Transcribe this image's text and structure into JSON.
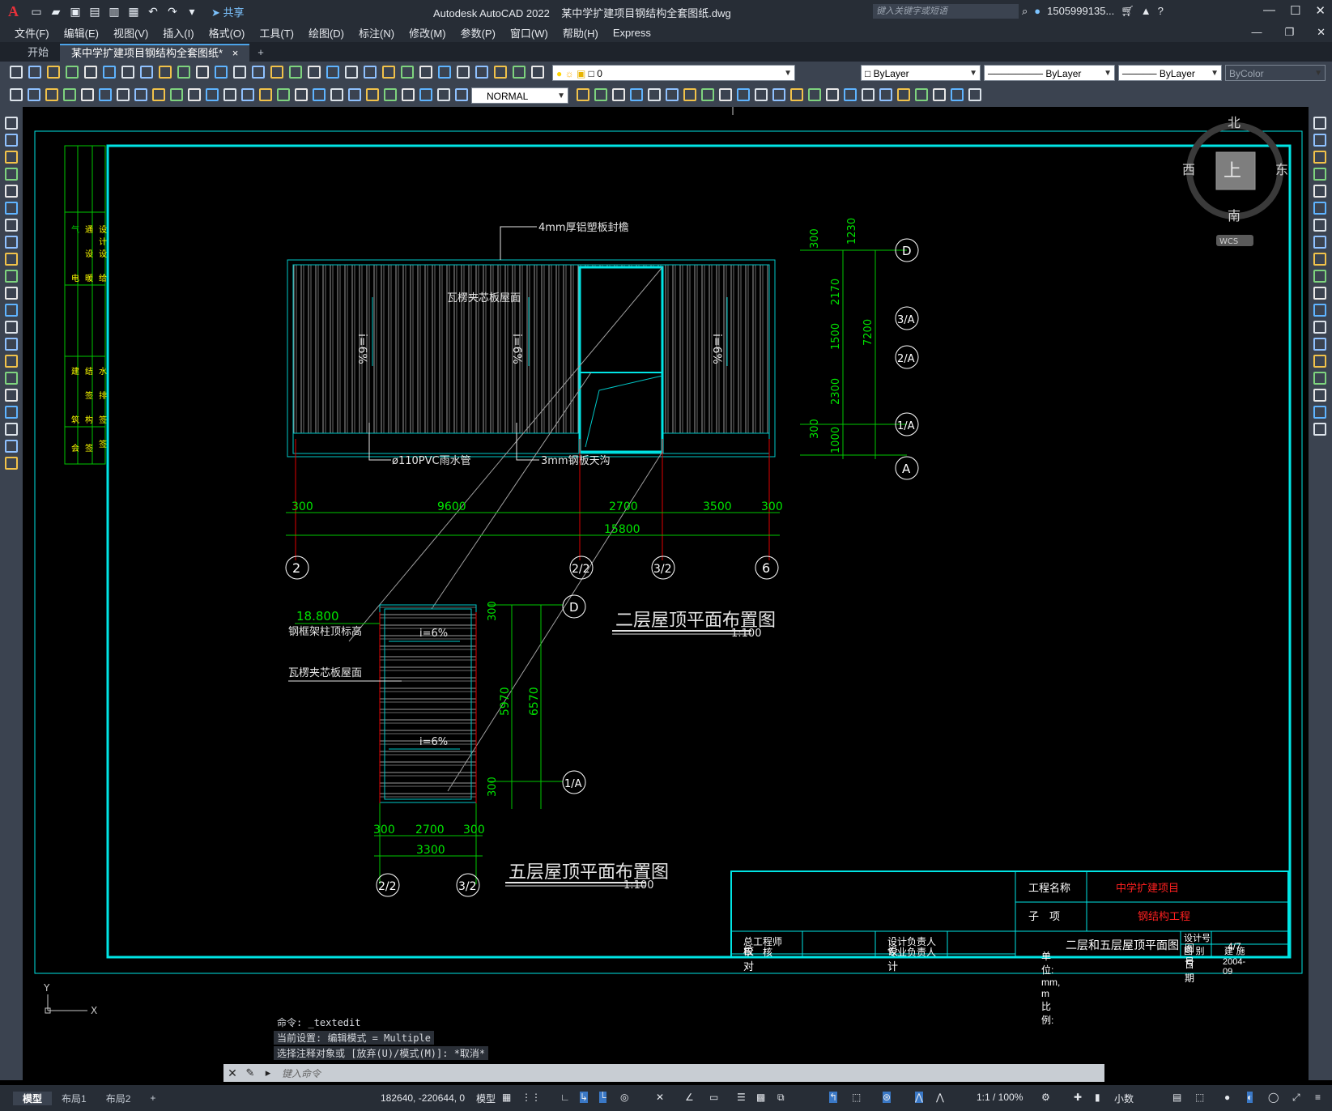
{
  "titlebar": {
    "logo": "A",
    "share_label": "共享",
    "app_title": "Autodesk AutoCAD 2022",
    "file_name": "某中学扩建项目钢结构全套图纸.dwg",
    "search_placeholder": "键入关键字或短语",
    "user": "1505999135...",
    "help": "?"
  },
  "menu": [
    "文件(F)",
    "编辑(E)",
    "视图(V)",
    "插入(I)",
    "格式(O)",
    "工具(T)",
    "绘图(D)",
    "标注(N)",
    "修改(M)",
    "参数(P)",
    "窗口(W)",
    "帮助(H)",
    "Express"
  ],
  "tabs": {
    "start": "开始",
    "active": "某中学扩建项目钢结构全套图纸*",
    "close": "×",
    "add": "+"
  },
  "toolbar": {
    "layer_name": "0",
    "color": "ByLayer",
    "linetype": "ByLayer",
    "lineweight": "ByLayer",
    "plotstyle": "ByColor",
    "textstyle": "NORMAL"
  },
  "viewcube": {
    "north": "北",
    "south": "南",
    "east": "东",
    "west": "西",
    "face": "上",
    "wcs": "WCS"
  },
  "drawing": {
    "title_plan1": "二层屋顶平面布置图",
    "scale_plan1": "1:100",
    "title_plan2": "五层屋顶平面布置图",
    "scale_plan2": "1:100",
    "label_fascia": "4mm厚铝塑板封檐",
    "label_roof": "瓦楞夹芯板屋面",
    "label_slope": "i=6%",
    "label_pipe": "ø110PVC雨水管",
    "label_gutter": "3mm钢板天沟",
    "label_elev": "18.800",
    "label_colhead": "钢框架柱顶标高",
    "label_roof2": "瓦楞夹芯板屋面",
    "dims_h": [
      "300",
      "9600",
      "2700",
      "3500",
      "300"
    ],
    "dim_total": "15800",
    "dims_v": [
      "300",
      "1230",
      "2170",
      "1500",
      "2300",
      "300",
      "1000"
    ],
    "dim_vtotal": "7200",
    "axes_bottom": [
      "2",
      "2/2",
      "3/2",
      "6"
    ],
    "axes_right": [
      "D",
      "3/A",
      "2/A",
      "1/A",
      "A"
    ],
    "plan2_dims_h": [
      "300",
      "2700",
      "300"
    ],
    "plan2_total": "3300",
    "plan2_dims_v": [
      "300",
      "5970",
      "6570",
      "300"
    ],
    "plan2_axes_right": [
      "D",
      "1/A"
    ],
    "plan2_axes_bottom": [
      "2/2",
      "3/2"
    ],
    "strip_top": [
      "气",
      "通",
      "设",
      "电",
      "暖",
      "给",
      "设",
      "设",
      "计"
    ],
    "strip_bottom": [
      "建",
      "结",
      "水",
      "筑",
      "构",
      "排",
      "签",
      "签",
      "签",
      "会",
      "签"
    ]
  },
  "titleblock": {
    "project_label": "工程名称",
    "project_value": "中学扩建项目",
    "sub_label": "子　项",
    "sub_value": "钢结构工程",
    "chief": "总工程师",
    "review": "审　核",
    "check": "校　对",
    "design_lead": "设计负责人",
    "pro_lead": "专业负责人",
    "design": "设　计",
    "drawing_title": "二层和五层屋顶平面图",
    "unit": "单位: mm, m 比例:",
    "design_no": "设计号",
    "category_label": "图 别",
    "category_value": "建 施",
    "number_label": "图 号",
    "number_value": "4/7",
    "date_label": "日 期",
    "date_value": "2004-09"
  },
  "command": {
    "history": [
      "命令: _textedit",
      "当前设置: 编辑模式 = Multiple",
      "选择注释对象或 [放弃(U)/模式(M)]: *取消*"
    ],
    "placeholder": "键入命令"
  },
  "status": {
    "tabs": [
      "模型",
      "布局1",
      "布局2"
    ],
    "add": "+",
    "coords": "182640, -220644, 0",
    "space": "模型",
    "scale": "1:1 / 100%",
    "units": "小数"
  }
}
